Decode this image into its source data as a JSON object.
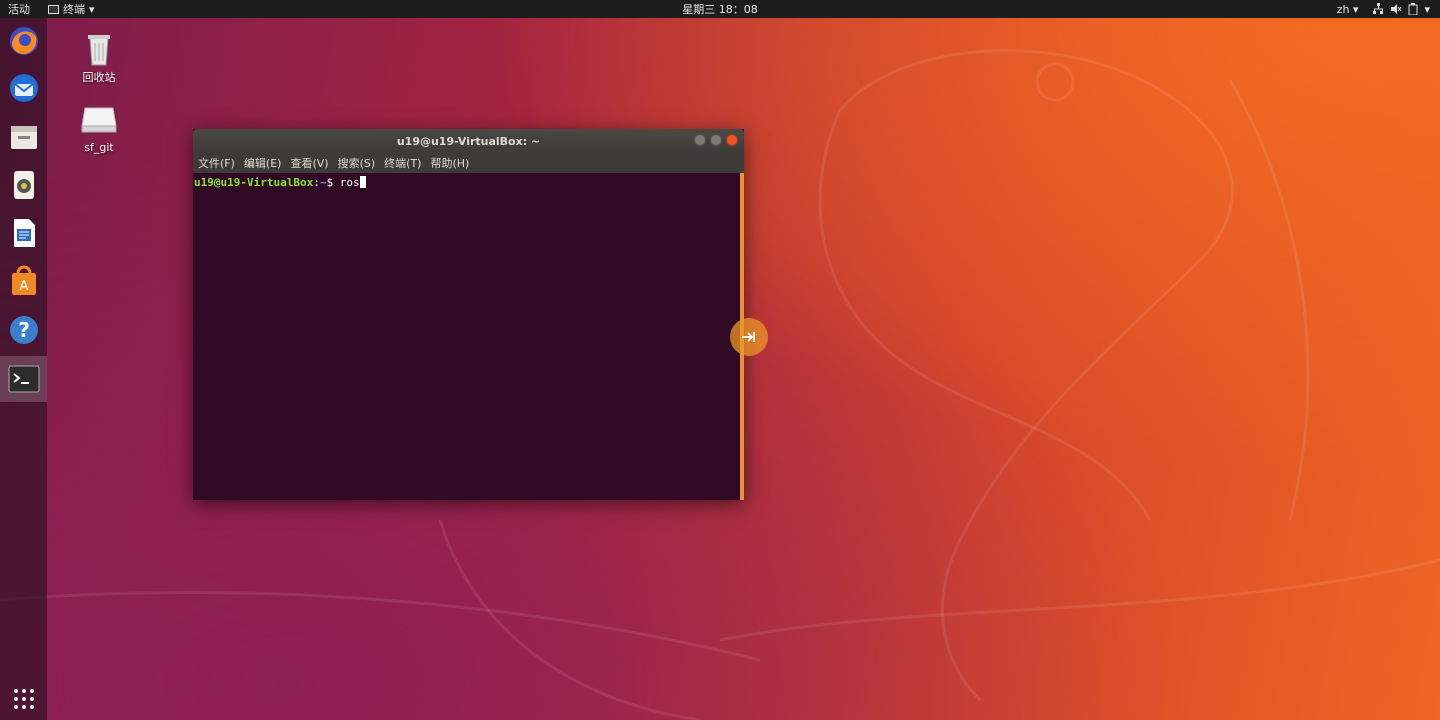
{
  "topbar": {
    "activities": "活动",
    "app_menu": "终端",
    "clock": "星期三 18：08",
    "lang": "zh"
  },
  "dock": {
    "items": [
      {
        "name": "firefox"
      },
      {
        "name": "thunderbird"
      },
      {
        "name": "files"
      },
      {
        "name": "rhythmbox"
      },
      {
        "name": "libreoffice-writer"
      },
      {
        "name": "software-center"
      },
      {
        "name": "help"
      },
      {
        "name": "terminal"
      },
      {
        "name": "show-applications"
      }
    ]
  },
  "desktop": {
    "icons": [
      {
        "label": "回收站",
        "icon": "trash-icon"
      },
      {
        "label": "sf_git",
        "icon": "drive-icon"
      }
    ]
  },
  "terminal": {
    "title": "u19@u19-VirtualBox: ~",
    "menu": [
      "文件(F)",
      "编辑(E)",
      "查看(V)",
      "搜索(S)",
      "终端(T)",
      "帮助(H)"
    ],
    "prompt_user": "u19@u19-VirtualBox",
    "prompt_sep": ":",
    "prompt_path": "~",
    "prompt_symbol": "$ ",
    "input": "ros"
  },
  "colors": {
    "terminal_bg": "#300a24",
    "prompt_green": "#8ae234",
    "prompt_blue": "#729fcf",
    "accent_orange": "#e8953a"
  }
}
